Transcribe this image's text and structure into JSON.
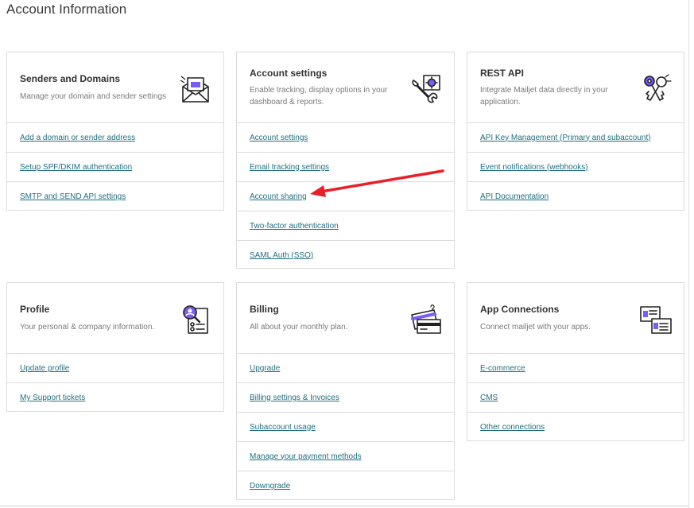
{
  "page": {
    "title": "Account Information"
  },
  "colors": {
    "link": "#1f6f80",
    "annotation_arrow": "#e8202a",
    "icon_accent": "#7b5cf5"
  },
  "cards": {
    "senders": {
      "title": "Senders and Domains",
      "description": "Manage your domain and sender settings",
      "icon": "envelope-icon",
      "links": [
        "Add a domain or sender address",
        "Setup SPF/DKIM authentication",
        "SMTP and SEND API settings"
      ]
    },
    "account": {
      "title": "Account settings",
      "description": "Enable tracking, display options in your dashboard & reports.",
      "icon": "wrench-gear-icon",
      "links": [
        "Account settings",
        "Email tracking settings",
        "Account sharing",
        "Two-factor authentication",
        "SAML Auth (SSO)"
      ]
    },
    "rest_api": {
      "title": "REST API",
      "description": "Integrate Mailjet data directly in your application.",
      "icon": "keys-icon",
      "links": [
        "API Key Management (Primary and subaccount)",
        "Event notifications (webhooks)",
        "API Documentation"
      ]
    },
    "profile": {
      "title": "Profile",
      "description": "Your personal & company information.",
      "icon": "profile-search-icon",
      "links": [
        "Update profile",
        "My Support tickets"
      ]
    },
    "billing": {
      "title": "Billing",
      "description": "All about your monthly plan.",
      "icon": "credit-card-icon",
      "links": [
        "Upgrade",
        "Billing settings & Invoices",
        "Subaccount usage",
        "Manage your payment methods",
        "Downgrade"
      ]
    },
    "app_connections": {
      "title": "App Connections",
      "description": "Connect mailjet with your apps.",
      "icon": "app-connect-icon",
      "links": [
        "E-commerce",
        "CMS",
        "Other connections"
      ]
    }
  }
}
